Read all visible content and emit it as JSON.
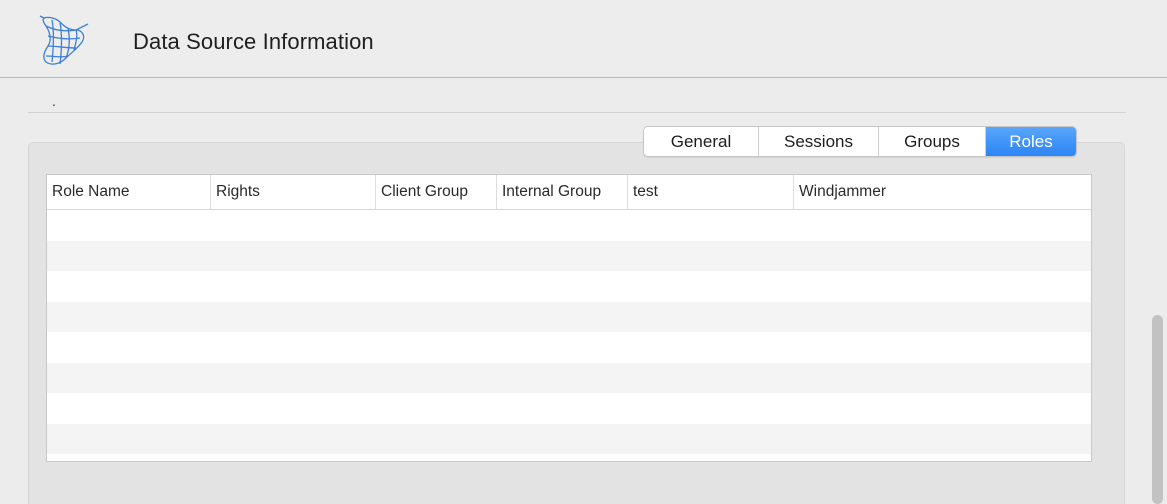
{
  "header": {
    "title": "Data Source Information",
    "icon": "sql-server-icon"
  },
  "content": {
    "dot_text": "."
  },
  "tabs": [
    {
      "label": "General",
      "active": false
    },
    {
      "label": "Sessions",
      "active": false
    },
    {
      "label": "Groups",
      "active": false
    },
    {
      "label": "Roles",
      "active": true
    }
  ],
  "table": {
    "columns": [
      "Role Name",
      "Rights",
      "Client Group",
      "Internal Group",
      "test",
      "Windjammer"
    ],
    "rows": []
  },
  "colors": {
    "accent": "#2b85f4",
    "icon_blue": "#3f7fd6"
  }
}
